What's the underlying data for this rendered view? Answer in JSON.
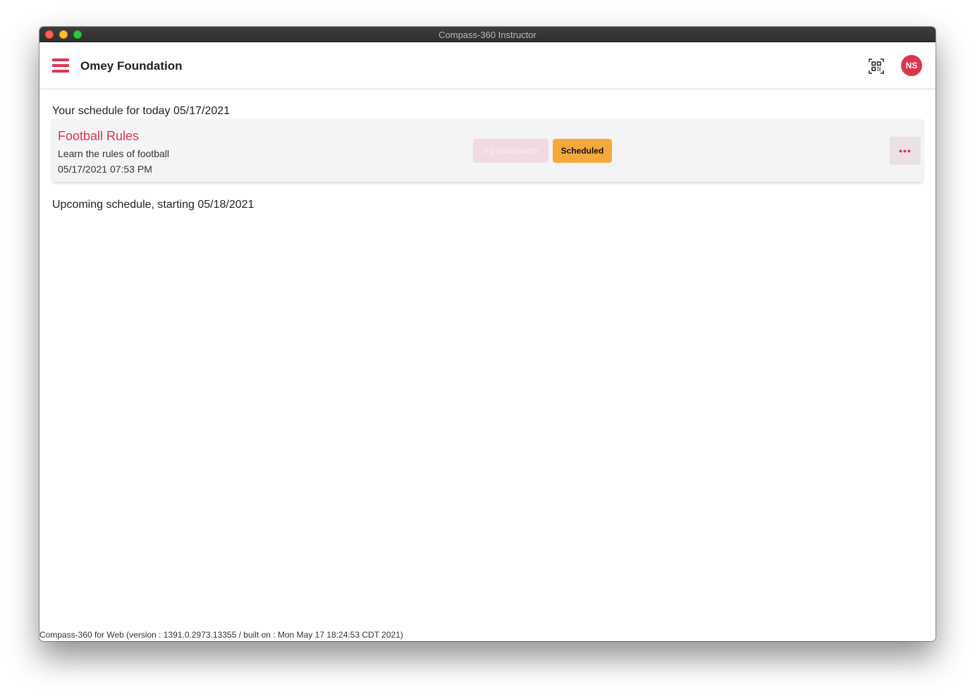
{
  "window": {
    "title": "Compass-360 Instructor"
  },
  "header": {
    "org_name": "Omey Foundation",
    "avatar_initials": "NS"
  },
  "schedule": {
    "today_title": "Your schedule for today 05/17/2021",
    "upcoming_title": "Upcoming schedule, starting 05/18/2021",
    "events": [
      {
        "title": "Football Rules",
        "description": "Learn the rules of football",
        "datetime": "05/17/2021 07:53 PM",
        "participants_label": "0 participants",
        "status": "Scheduled",
        "more_label": "•••"
      }
    ]
  },
  "footer": {
    "text": "Compass-360 for Web (version : 1391.0.2973.13355 / built on : Mon May 17 18:24:53 CDT 2021)"
  },
  "colors": {
    "accent": "#dc3550",
    "status_scheduled": "#f4a93a"
  },
  "icons": {
    "menu": "hamburger-icon",
    "qr": "qr-code-scan-icon"
  }
}
